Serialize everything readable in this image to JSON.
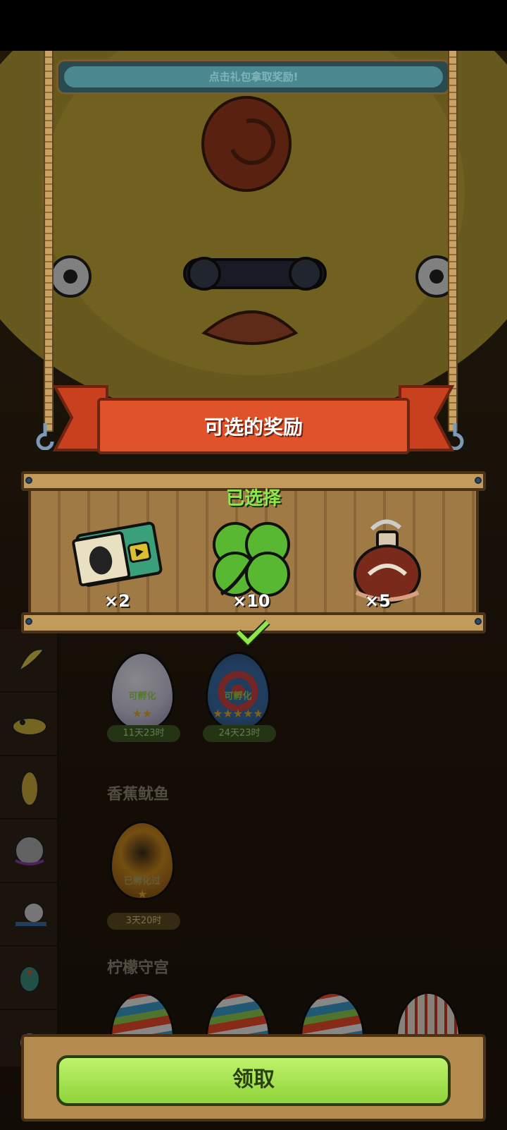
{
  "hint_text": "点击礼包拿取奖励!",
  "panel_title": "可选的奖励",
  "selected_label": "已选择",
  "rewards": [
    {
      "name": "ticket",
      "qty": "×2"
    },
    {
      "name": "clover",
      "qty": "×10"
    },
    {
      "name": "potion",
      "qty": "×5"
    }
  ],
  "eggs_row1": [
    {
      "status": "可孵化",
      "stars": "★★",
      "timer": "11天23时"
    },
    {
      "status": "可孵化",
      "stars": "★★★★★",
      "timer": "24天23时"
    }
  ],
  "section1_title": "香蕉鱿鱼",
  "egg_row2": {
    "status": "已孵化过",
    "stars": "★",
    "timer": "3天20时"
  },
  "section2_title": "柠檬守宫",
  "claim_button": "领取",
  "colors": {
    "ribbon": "#e0522a",
    "button": "#a6e34f",
    "selected": "#8ee84b"
  }
}
